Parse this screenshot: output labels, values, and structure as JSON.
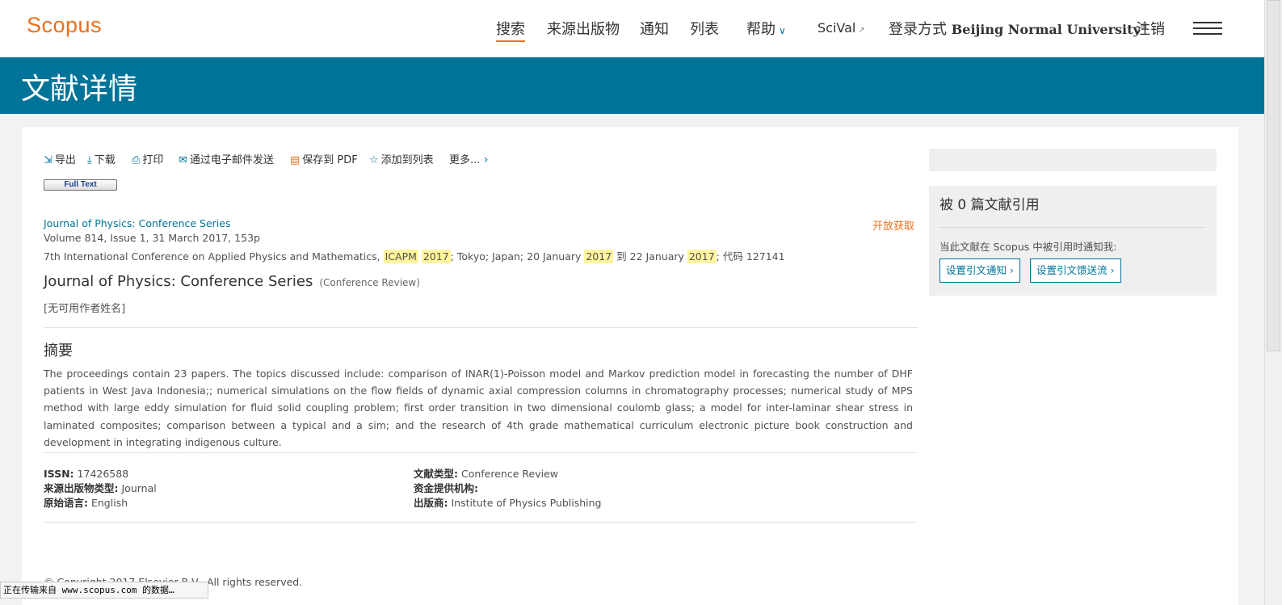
{
  "header": {
    "logo": "Scopus",
    "nav": {
      "search": "搜索",
      "sources": "来源出版物",
      "alerts": "通知",
      "lists": "列表",
      "help": "帮助",
      "scival": "SciVal",
      "login_prefix": "登录方式",
      "institution": "Beijing Normal University",
      "logout": "注销"
    }
  },
  "page_title": "文献详情",
  "toolbar": {
    "export": "导出",
    "download": "下载",
    "print": "打印",
    "email": "通过电子邮件发送",
    "save_pdf": "保存到 PDF",
    "add_to_list": "添加到列表",
    "more": "更多..."
  },
  "full_text_button": "Full Text",
  "document": {
    "source_link": "Journal of Physics: Conference Series",
    "open_access": "开放获取",
    "volume_line": "Volume 814, Issue 1, 31 March 2017, 153p",
    "conference": {
      "name": "7th International Conference on Applied Physics and Mathematics, ",
      "acronym": "ICAPM",
      "year": "2017",
      "location": "; Tokyo; Japan; 20 January ",
      "to": " 到 22 January ",
      "code": "; 代码 127141"
    },
    "title": "Journal of Physics: Conference Series",
    "title_type": "(Conference Review)",
    "authors": "[无可用作者姓名]"
  },
  "abstract": {
    "heading": "摘要",
    "text": "The proceedings contain 23 papers. The topics discussed include: comparison of INAR(1)-Poisson model and Markov prediction model in forecasting the number of DHF patients in West Java Indonesia;; numerical simulations on the flow fields of dynamic axial compression columns in chromatography processes; numerical study of MPS method with large eddy simulation for fluid solid coupling problem; first order transition in two dimensional coulomb glass; a model for inter-laminar shear stress in laminated composites; comparison between a typical and a sim; and the research of 4th grade mathematical curriculum electronic picture book construction and development in integrating indigenous culture."
  },
  "facts": {
    "issn_label": "ISSN:",
    "issn": "17426588",
    "source_type_label": "来源出版物类型:",
    "source_type": "Journal",
    "language_label": "原始语言:",
    "language": "English",
    "doc_type_label": "文献类型:",
    "doc_type": "Conference Review",
    "funding_label": "资金提供机构:",
    "publisher_label": "出版商:",
    "publisher": "Institute of Physics Publishing"
  },
  "copyright": "© Copyright 2017 Elsevier B.V., All rights reserved.",
  "sidebar": {
    "cited_by": "被 0 篇文献引用",
    "notify_text": "当此文献在 Scopus 中被引用时通知我:",
    "set_alert": "设置引文通知",
    "set_feed": "设置引文馈送流"
  },
  "status_bar": "正在传输来自 www.scopus.com 的数据…",
  "colors": {
    "brand_orange": "#e9711c",
    "brand_blue": "#007398",
    "highlight": "#fff59d"
  }
}
